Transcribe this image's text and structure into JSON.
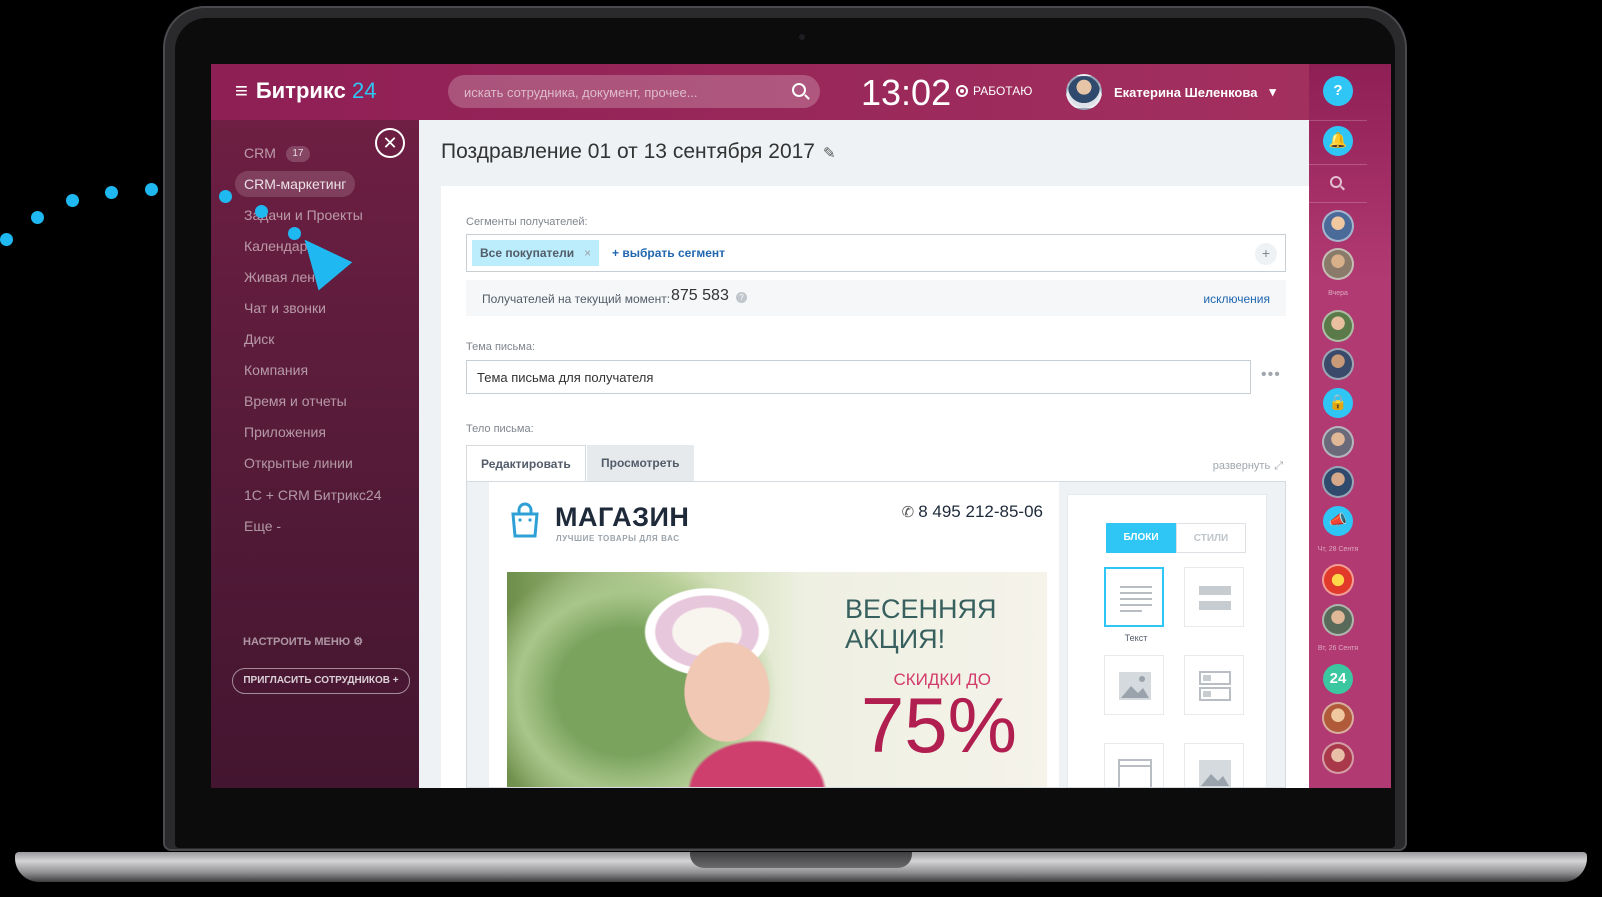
{
  "header": {
    "logo_prefix": "Битрикс",
    "logo_number": "24",
    "search_placeholder": "искать сотрудника, документ, прочее...",
    "clock": "13:02",
    "work_status": "РАБОТАЮ",
    "user_name": "Екатерина Шеленкова",
    "user_caret": "▾",
    "help_label": "?"
  },
  "sidebar": {
    "items": [
      {
        "label": "CRM",
        "badge": "17"
      },
      {
        "label": "CRM-маркетинг"
      },
      {
        "label": "Задачи и Проекты"
      },
      {
        "label": "Календарь"
      },
      {
        "label": "Живая лента"
      },
      {
        "label": "Чат и звонки"
      },
      {
        "label": "Диск"
      },
      {
        "label": "Компания"
      },
      {
        "label": "Время и отчеты"
      },
      {
        "label": "Приложения"
      },
      {
        "label": "Открытые линии"
      },
      {
        "label": "1С + CRM Битрикс24"
      },
      {
        "label": "Еще -"
      }
    ],
    "configure_label": "НАСТРОИТЬ МЕНЮ",
    "invite_label": "ПРИГЛАСИТЬ СОТРУДНИКОВ +"
  },
  "main": {
    "title": "Поздравление 01 от 13 сентября 2017",
    "segments_label": "Сегменты получателей:",
    "segment_tag": "Все покупатели",
    "add_segment": "+ выбрать сегмент",
    "recipients_label": "Получателей на текущий момент:",
    "recipients_count": "875 583",
    "exclusions": "исключения",
    "subject_label": "Тема письма:",
    "subject_value": "Тема письма для получателя",
    "body_label": "Тело письма:",
    "tabs": [
      {
        "label": "Редактировать"
      },
      {
        "label": "Просмотреть"
      }
    ],
    "expand_label": "развернуть"
  },
  "email": {
    "shop_name": "МАГАЗИН",
    "shop_tagline": "ЛУЧШИЕ ТОВАРЫ ДЛЯ ВАС",
    "phone": "8 495 212-85-06",
    "banner_title": "ВЕСЕННЯЯ АКЦИЯ!",
    "banner_sub": "СКИДКИ ДО",
    "banner_pct": "75%"
  },
  "blocks_panel": {
    "tab_blocks": "БЛОКИ",
    "tab_styles": "СТИЛИ",
    "text_block_label": "Текст"
  },
  "rail": {
    "date_yesterday": "Вчера",
    "date_1": "Чт, 28 Сентя",
    "date_2": "Вт, 26 Сентя",
    "badge_24": "24"
  },
  "colors": {
    "brand": "#2fc6f6",
    "header": "#8e1f55",
    "accent_link": "#2067b0"
  }
}
